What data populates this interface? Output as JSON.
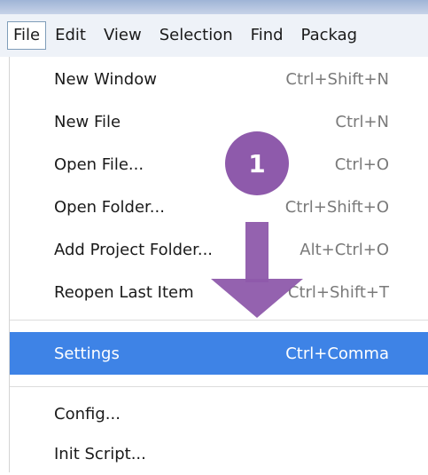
{
  "menubar": {
    "items": [
      {
        "label": "File",
        "active": true
      },
      {
        "label": "Edit"
      },
      {
        "label": "View"
      },
      {
        "label": "Selection"
      },
      {
        "label": "Find"
      },
      {
        "label": "Packag"
      }
    ]
  },
  "menu": {
    "items": [
      {
        "label": "New Window",
        "shortcut": "Ctrl+Shift+N"
      },
      {
        "label": "New File",
        "shortcut": "Ctrl+N"
      },
      {
        "label": "Open File...",
        "shortcut": "Ctrl+O"
      },
      {
        "label": "Open Folder...",
        "shortcut": "Ctrl+Shift+O"
      },
      {
        "label": "Add Project Folder...",
        "shortcut": "Alt+Ctrl+O"
      },
      {
        "label": "Reopen Last Item",
        "shortcut": "Ctrl+Shift+T"
      },
      {
        "label": "Settings",
        "shortcut": "Ctrl+Comma",
        "highlighted": true
      },
      {
        "label": "Config...",
        "shortcut": ""
      },
      {
        "label": "Init Script...",
        "shortcut": ""
      }
    ]
  },
  "annotation": {
    "step_number": "1",
    "color": "#8e5aab"
  },
  "colors": {
    "highlight": "#3e83e6",
    "shortcut_text": "#7a7a7a"
  }
}
